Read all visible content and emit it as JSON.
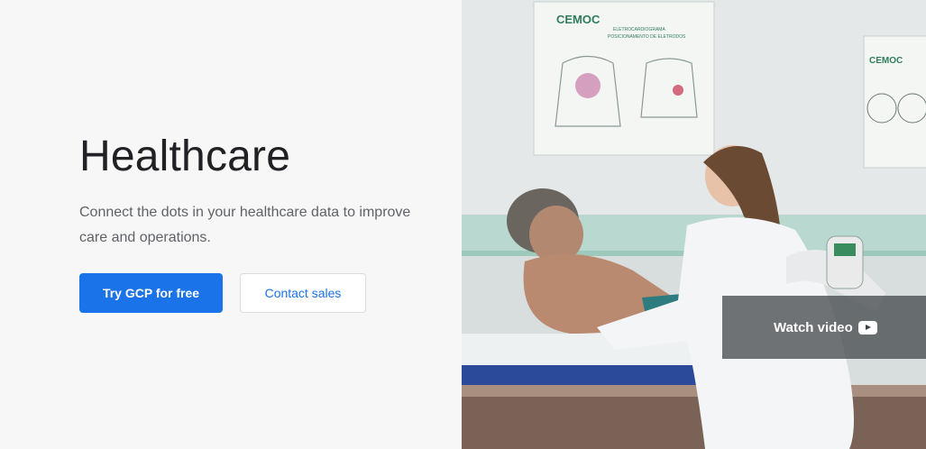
{
  "hero": {
    "title": "Healthcare",
    "subtitle": "Connect the dots in your healthcare data to improve care and operations.",
    "primary_button": "Try GCP for free",
    "secondary_button": "Contact sales"
  },
  "media": {
    "watch_label": "Watch video",
    "play_icon": "youtube-play-icon",
    "poster_text_1": "CEMOC",
    "poster_text_2": "ELETROCARDIOGRAMA",
    "poster_text_3": "POSICIONAMENTO DE ELETRODOS"
  },
  "colors": {
    "primary": "#1a73e8",
    "title": "#202124",
    "body_text": "#5f6368",
    "left_bg": "#f7f7f7"
  }
}
